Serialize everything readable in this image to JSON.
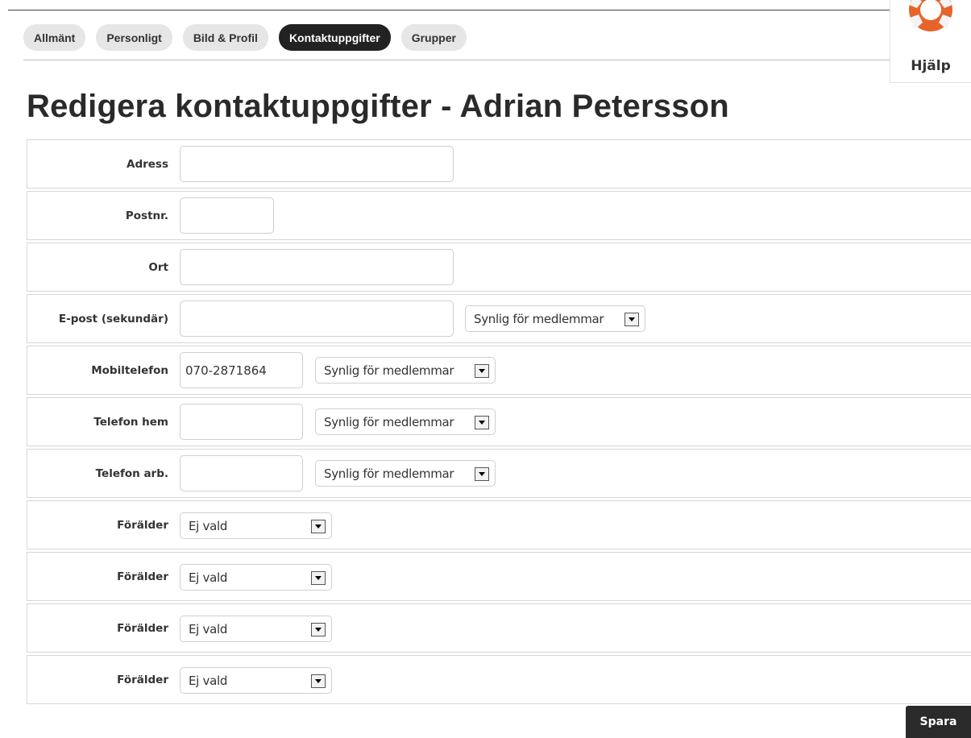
{
  "tabs": [
    {
      "label": "Allmänt"
    },
    {
      "label": "Personligt"
    },
    {
      "label": "Bild & Profil"
    },
    {
      "label": "Kontaktuppgifter"
    },
    {
      "label": "Grupper"
    }
  ],
  "active_tab": "Kontaktuppgifter",
  "help": {
    "label": "Hjälp",
    "icon": "lifebuoy-icon",
    "color": "#e8632a"
  },
  "page_title": "Redigera kontaktuppgifter - Adrian Petersson",
  "form": {
    "address": {
      "label": "Adress",
      "value": ""
    },
    "postal_code": {
      "label": "Postnr.",
      "value": ""
    },
    "city": {
      "label": "Ort",
      "value": ""
    },
    "email_secondary": {
      "label": "E-post (sekundär)",
      "value": "",
      "visibility": "Synlig för medlemmar"
    },
    "mobile": {
      "label": "Mobiltelefon",
      "value": "070-2871864",
      "visibility": "Synlig för medlemmar"
    },
    "phone_home": {
      "label": "Telefon hem",
      "value": "",
      "visibility": "Synlig för medlemmar"
    },
    "phone_work": {
      "label": "Telefon arb.",
      "value": "",
      "visibility": "Synlig för medlemmar"
    },
    "parents": [
      {
        "label": "Förälder",
        "value": "Ej vald"
      },
      {
        "label": "Förälder",
        "value": "Ej vald"
      },
      {
        "label": "Förälder",
        "value": "Ej vald"
      },
      {
        "label": "Förälder",
        "value": "Ej vald"
      }
    ]
  },
  "save_label": "Spara"
}
